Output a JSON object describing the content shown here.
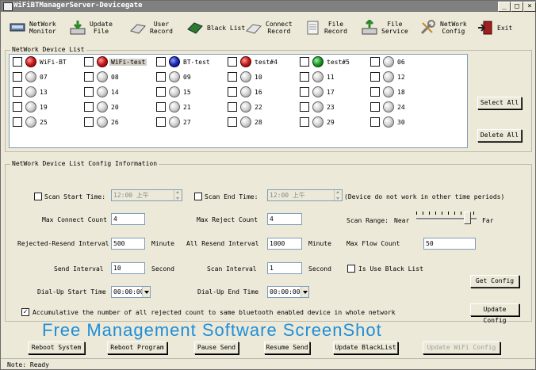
{
  "window": {
    "title": "WiFiBTManagerServer-Devicegate"
  },
  "toolbar": {
    "items": [
      {
        "label1": "NetWork",
        "label2": "Monitor",
        "icon": "network-monitor-icon"
      },
      {
        "label1": "Update",
        "label2": "File",
        "icon": "update-file-icon"
      },
      {
        "label1": "User",
        "label2": "Record",
        "icon": "user-record-icon"
      },
      {
        "label1": "Black List",
        "label2": "",
        "icon": "black-list-icon"
      },
      {
        "label1": "Connect",
        "label2": "Record",
        "icon": "connect-record-icon"
      },
      {
        "label1": "File",
        "label2": "Record",
        "icon": "file-record-icon"
      },
      {
        "label1": "File",
        "label2": "Service",
        "icon": "file-service-icon"
      },
      {
        "label1": "NetWork",
        "label2": "Config",
        "icon": "network-config-icon"
      },
      {
        "label1": "Exit",
        "label2": "",
        "icon": "exit-icon"
      }
    ]
  },
  "device_list": {
    "title": "NetWork Device List",
    "devices": [
      {
        "name": "WiFi-BT",
        "status": "red"
      },
      {
        "name": "WiFi-test",
        "status": "red",
        "selected": true
      },
      {
        "name": "BT-test",
        "status": "blue"
      },
      {
        "name": "test#4",
        "status": "red"
      },
      {
        "name": "test#5",
        "status": "green"
      },
      {
        "name": "06",
        "status": "gray"
      },
      {
        "name": "07",
        "status": "gray"
      },
      {
        "name": "08",
        "status": "gray"
      },
      {
        "name": "09",
        "status": "gray"
      },
      {
        "name": "10",
        "status": "gray"
      },
      {
        "name": "11",
        "status": "gray"
      },
      {
        "name": "12",
        "status": "gray"
      },
      {
        "name": "13",
        "status": "gray"
      },
      {
        "name": "14",
        "status": "gray"
      },
      {
        "name": "15",
        "status": "gray"
      },
      {
        "name": "16",
        "status": "gray"
      },
      {
        "name": "17",
        "status": "gray"
      },
      {
        "name": "18",
        "status": "gray"
      },
      {
        "name": "19",
        "status": "gray"
      },
      {
        "name": "20",
        "status": "gray"
      },
      {
        "name": "21",
        "status": "gray"
      },
      {
        "name": "22",
        "status": "gray"
      },
      {
        "name": "23",
        "status": "gray"
      },
      {
        "name": "24",
        "status": "gray"
      },
      {
        "name": "25",
        "status": "gray"
      },
      {
        "name": "26",
        "status": "gray"
      },
      {
        "name": "27",
        "status": "gray"
      },
      {
        "name": "28",
        "status": "gray"
      },
      {
        "name": "29",
        "status": "gray"
      },
      {
        "name": "30",
        "status": "gray"
      }
    ],
    "select_all": "Select All",
    "delete_all": "Delete All"
  },
  "config": {
    "title": "NetWork Device List Config Information",
    "scan_start_label": "Scan Start Time:",
    "scan_start_value": "12:00 上午",
    "scan_end_label": "Scan End Time:",
    "scan_end_value": "12:00 上午",
    "scan_note": "(Device do not work in other time periods)",
    "max_connect_label": "Max Connect Count",
    "max_connect_value": "4",
    "max_reject_label": "Max Reject Count",
    "max_reject_value": "4",
    "scan_range_label": "Scan Range:",
    "scan_range_near": "Near",
    "scan_range_far": "Far",
    "scan_range_level": 0.85,
    "rejected_resend_label": "Rejected-Resend Interval",
    "rejected_resend_value": "500",
    "minute1": "Minute",
    "all_resend_label": "All Resend Interval",
    "all_resend_value": "1000",
    "minute2": "Minute",
    "max_flow_label": "Max Flow Count",
    "max_flow_value": "50",
    "send_interval_label": "Send Interval",
    "send_interval_value": "10",
    "second1": "Second",
    "scan_interval_label": "Scan Interval",
    "scan_interval_value": "1",
    "second2": "Second",
    "use_black_list_label": "Is Use Black List",
    "get_config": "Get Config",
    "dialup_start_label": "Dial-Up Start Time",
    "dialup_start_value": "00:00:00",
    "dialup_end_label": "Dial-Up End Time",
    "dialup_end_value": "00:00:00",
    "accumulative_label": "Accumulative the number of all rejected count to same bluetooth enabled device in whole network",
    "update_config": "Update Config"
  },
  "watermark": "Free Management Software ScreenShot",
  "bottom_buttons": {
    "reboot_system": "Reboot System",
    "reboot_program": "Reboot Program",
    "pause_send": "Pause Send",
    "resume_send": "Resume Send",
    "update_blacklist": "Update BlackList",
    "update_wifi_config": "Update WiFi Config"
  },
  "status": "Note: Ready"
}
